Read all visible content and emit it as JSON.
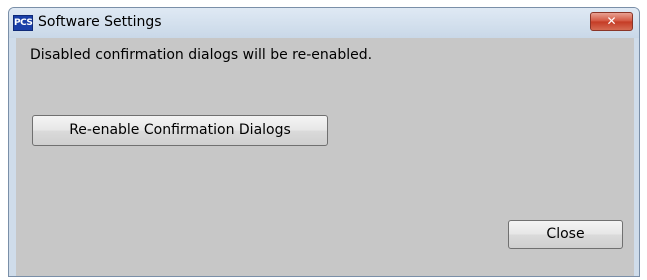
{
  "window": {
    "title": "Software Settings",
    "app_icon_text": "PCS",
    "close_icon": "close-icon"
  },
  "content": {
    "message": "Disabled confirmation dialogs will be re-enabled.",
    "reenable_label": "Re-enable Confirmation Dialogs",
    "close_label": "Close"
  },
  "colors": {
    "dialog_background": "#c7c7c7",
    "frame": "#cfdcea",
    "close_button": "#c43a24"
  }
}
